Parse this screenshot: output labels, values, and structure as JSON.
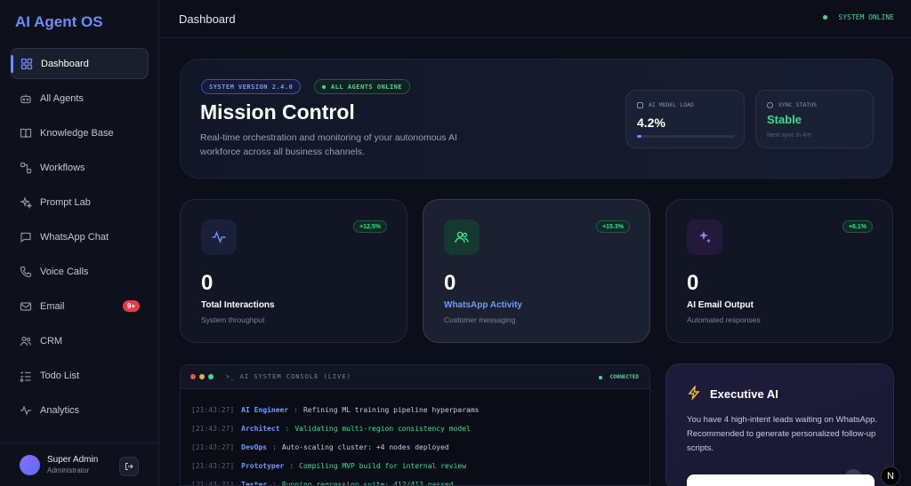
{
  "app": {
    "logo": "AI Agent OS"
  },
  "sidebar": {
    "items": [
      {
        "label": "Dashboard",
        "icon": "grid-icon",
        "active": true
      },
      {
        "label": "All Agents",
        "icon": "bot-icon"
      },
      {
        "label": "Knowledge Base",
        "icon": "book-icon"
      },
      {
        "label": "Workflows",
        "icon": "workflow-icon"
      },
      {
        "label": "Prompt Lab",
        "icon": "sparkles-icon"
      },
      {
        "label": "WhatsApp Chat",
        "icon": "chat-icon"
      },
      {
        "label": "Voice Calls",
        "icon": "phone-icon"
      },
      {
        "label": "Email",
        "icon": "mail-icon",
        "badge": "9+"
      },
      {
        "label": "CRM",
        "icon": "users-icon"
      },
      {
        "label": "Todo List",
        "icon": "checklist-icon"
      },
      {
        "label": "Analytics",
        "icon": "activity-icon"
      }
    ],
    "user": {
      "name": "Super Admin",
      "role": "Administrator"
    }
  },
  "topbar": {
    "title": "Dashboard",
    "status": "SYSTEM ONLINE"
  },
  "hero": {
    "version_pill": "SYSTEM VERSION 2.4.0",
    "online_pill": "ALL AGENTS ONLINE",
    "title": "Mission Control",
    "description": "Real-time orchestration and monitoring of your autonomous AI workforce across all business channels.",
    "model_load": {
      "label": "AI MODEL LOAD",
      "value": "4.2%",
      "fraction": 0.042
    },
    "sync": {
      "label": "SYNC STATUS",
      "value": "Stable",
      "sub": "Next sync in 4m"
    }
  },
  "stats": [
    {
      "value": "0",
      "label": "Total Interactions",
      "sub": "System throughput",
      "trend": "+12.5%",
      "icon": "activity-icon"
    },
    {
      "value": "0",
      "label": "WhatsApp Activity",
      "sub": "Customer messaging",
      "trend": "+15.3%",
      "icon": "users-icon"
    },
    {
      "value": "0",
      "label": "AI Email Output",
      "sub": "Automated responses",
      "trend": "+6.1%",
      "icon": "sparkles-icon"
    }
  ],
  "console": {
    "title": ">_ AI SYSTEM CONSOLE (LIVE)",
    "status": "CONNECTED",
    "lines": [
      {
        "time": "[21:43:27]",
        "role": "AI Engineer",
        "msg": "Refining ML training pipeline hyperparams",
        "color": "#c8cbe0"
      },
      {
        "time": "[21:43:27]",
        "role": "Architect",
        "msg": "Validating multi-region consistency model",
        "color": "#3ddc97"
      },
      {
        "time": "[21:43:27]",
        "role": "DevOps",
        "msg": "Auto-scaling cluster: +4 nodes deployed",
        "color": "#c8cbe0"
      },
      {
        "time": "[21:43:27]",
        "role": "Prototyper",
        "msg": "Compiling MVP build for internal review",
        "color": "#3ddc97"
      },
      {
        "time": "[21:43:31]",
        "role": "Tester",
        "msg": "Running regression suite: 412/412 passed",
        "color": "#3ddc97"
      }
    ]
  },
  "executive": {
    "title": "Executive AI",
    "text": "You have 4 high-intent leads waiting on WhatsApp. Recommended to generate personalized follow-up scripts."
  },
  "floating_badge": "N",
  "colors": {
    "accent": "#6d8dfc",
    "success": "#3ddc97",
    "danger": "#e23d4c"
  }
}
